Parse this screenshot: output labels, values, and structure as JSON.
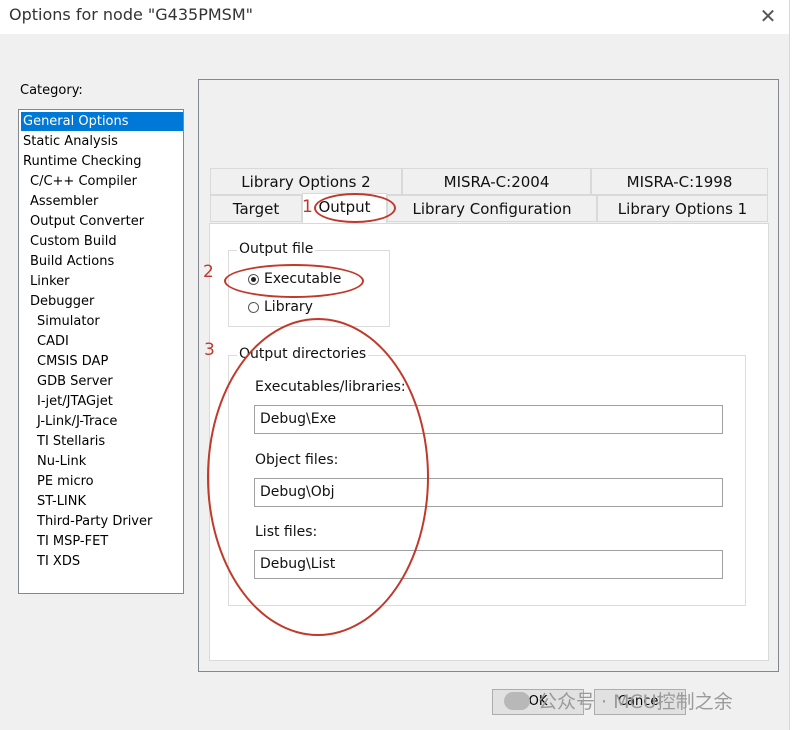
{
  "window": {
    "title": "Options for node \"G435PMSM\""
  },
  "category": {
    "label": "Category:",
    "items": [
      {
        "label": "General Options"
      },
      {
        "label": "Static Analysis"
      },
      {
        "label": "Runtime Checking"
      },
      {
        "label": "C/C++ Compiler"
      },
      {
        "label": "Assembler"
      },
      {
        "label": "Output Converter"
      },
      {
        "label": "Custom Build"
      },
      {
        "label": "Build Actions"
      },
      {
        "label": "Linker"
      },
      {
        "label": "Debugger"
      },
      {
        "label": "Simulator"
      },
      {
        "label": "CADI"
      },
      {
        "label": "CMSIS DAP"
      },
      {
        "label": "GDB Server"
      },
      {
        "label": "I-jet/JTAGjet"
      },
      {
        "label": "J-Link/J-Trace"
      },
      {
        "label": "TI Stellaris"
      },
      {
        "label": "Nu-Link"
      },
      {
        "label": "PE micro"
      },
      {
        "label": "ST-LINK"
      },
      {
        "label": "Third-Party Driver"
      },
      {
        "label": "TI MSP-FET"
      },
      {
        "label": "TI XDS"
      }
    ],
    "selected": "General Options"
  },
  "tabs": {
    "row1": [
      "Library Options 2",
      "MISRA-C:2004",
      "MISRA-C:1998"
    ],
    "row2": [
      "Target",
      "Output",
      "Library Configuration",
      "Library Options 1"
    ],
    "active": "Output"
  },
  "output_file": {
    "label": "Output file",
    "options": [
      "Executable",
      "Library"
    ],
    "selected": "Executable"
  },
  "output_dirs": {
    "label": "Output directories",
    "exe_label": "Executables/libraries:",
    "exe_value": "Debug\\Exe",
    "obj_label": "Object files:",
    "obj_value": "Debug\\Obj",
    "list_label": "List files:",
    "list_value": "Debug\\List"
  },
  "annotations": [
    "1",
    "2",
    "3"
  ],
  "buttons": {
    "ok": "OK",
    "cancel": "Cancel"
  },
  "watermark": "公众号 · MCU控制之余",
  "colors": {
    "selection": "#0078d7",
    "annotation": "#c0392b"
  }
}
